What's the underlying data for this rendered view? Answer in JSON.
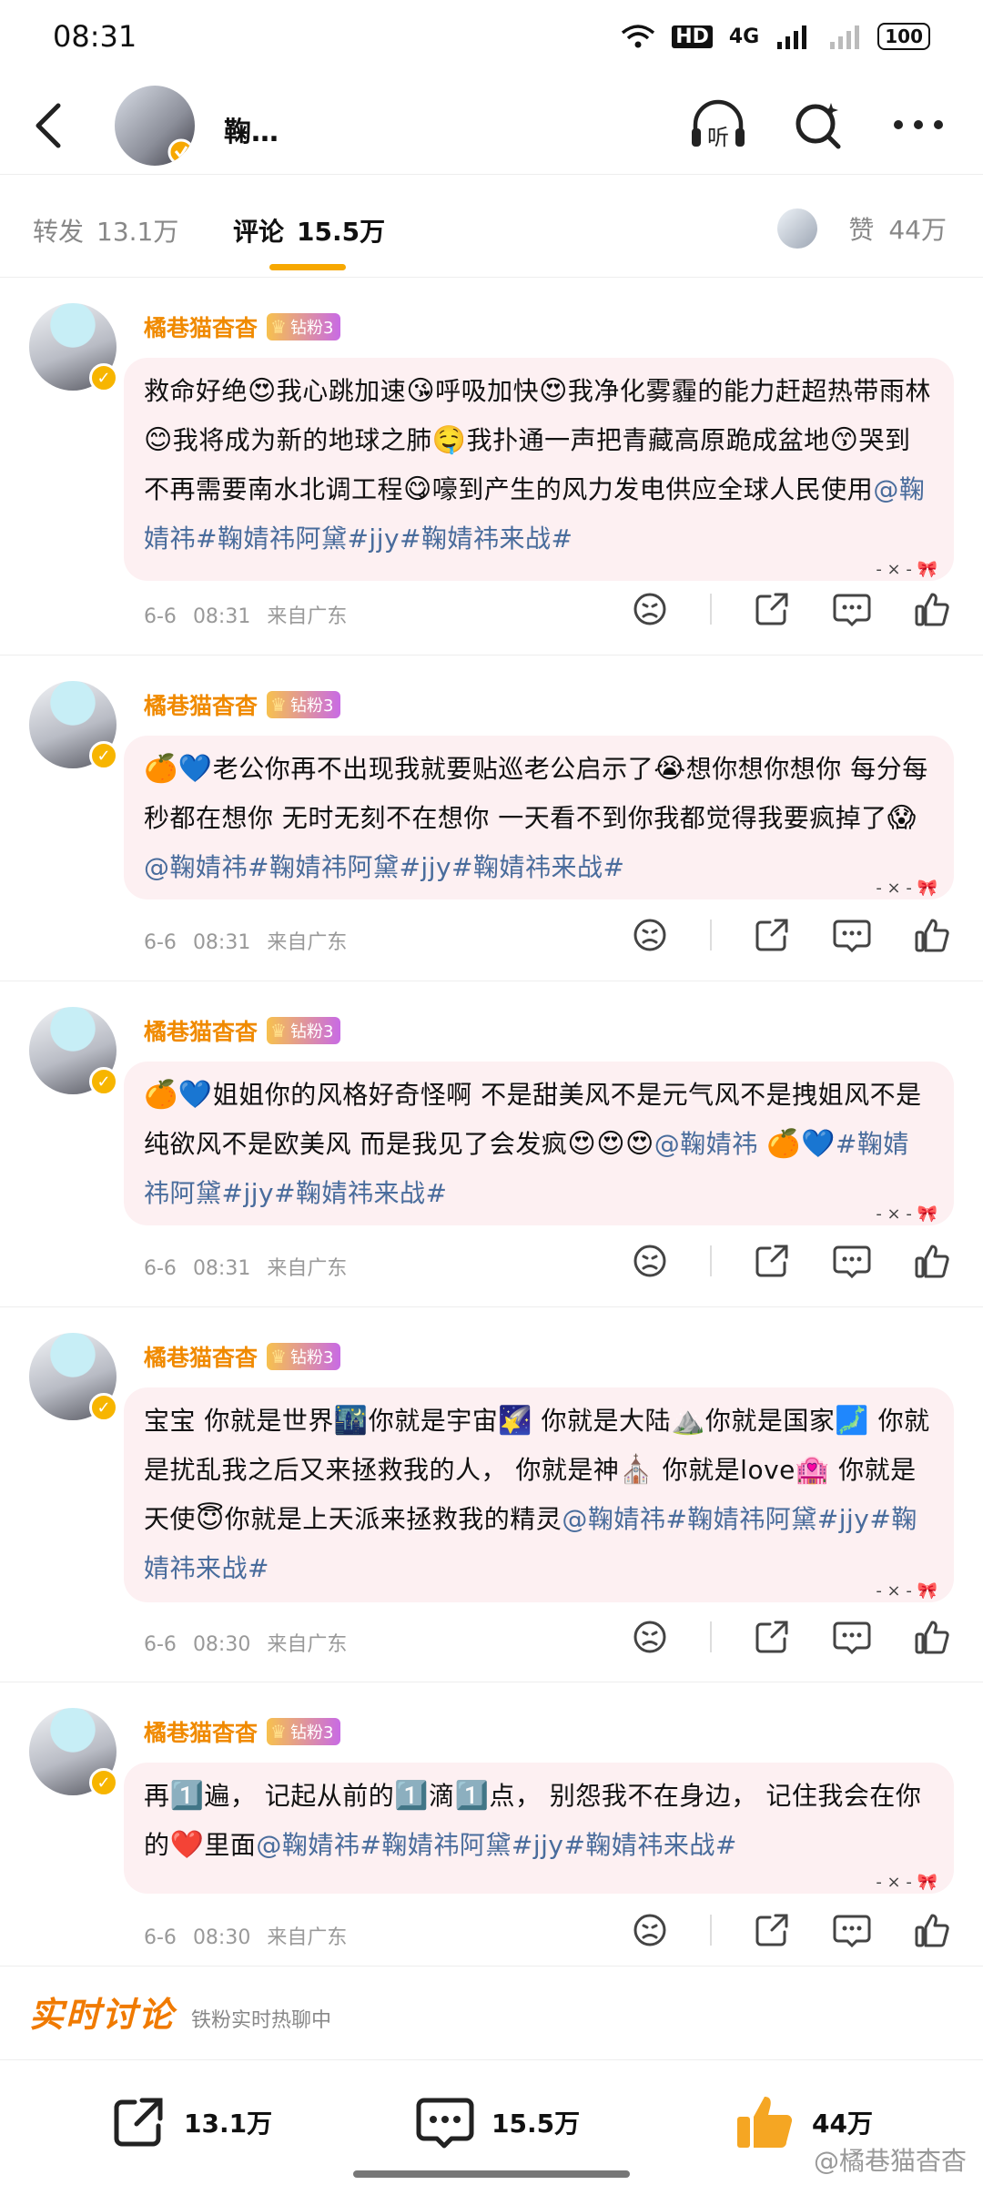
{
  "status": {
    "time": "08:31",
    "hd": "HD",
    "net": "4G",
    "battery": "100"
  },
  "header": {
    "name": "鞠…",
    "back": "back",
    "icons": [
      "listen-icon",
      "search-icon",
      "more-icon"
    ],
    "listen_label": "听"
  },
  "tabs": [
    {
      "label": "转发",
      "count": "13.1万"
    },
    {
      "label": "评论",
      "count": "15.5万"
    }
  ],
  "likes_tab": {
    "label": "赞",
    "count": "44万"
  },
  "comments": [
    {
      "user": "橘巷猫杳杳",
      "fan_badge": "钻粉3",
      "segments": [
        {
          "t": "救命好绝"
        },
        {
          "e": "😍"
        },
        {
          "t": "我心跳加速"
        },
        {
          "e": "😘"
        },
        {
          "t": "呼吸加快"
        },
        {
          "e": "😍"
        },
        {
          "t": "我净化雾霾的能力赶超热带雨林"
        },
        {
          "e": "😊"
        },
        {
          "t": "我将成为新的地球之肺"
        },
        {
          "e": "🤤"
        },
        {
          "t": "我扑通一声把青藏高原跪成盆地"
        },
        {
          "e": "😙"
        },
        {
          "t": "哭到不再需要南水北调工程"
        },
        {
          "e": "😋"
        },
        {
          "t": "嚎到产生的风力发电供应全球人民使用"
        },
        {
          "a": "@鞠婧祎#鞠婧祎阿黛#jjy#鞠婧祎来战#"
        }
      ],
      "date": "6-6",
      "time": "08:31",
      "location": "来自广东"
    },
    {
      "user": "橘巷猫杳杳",
      "fan_badge": "钻粉3",
      "segments": [
        {
          "e": "🍊"
        },
        {
          "e": "💙"
        },
        {
          "t": "老公你再不出现我就要贴巡老公启示了"
        },
        {
          "e": "😭"
        },
        {
          "t": "想你想你想你  每分每秒都在想你  无时无刻不在想你  一天看不到你我都觉得我要疯掉了"
        },
        {
          "e": "😱"
        },
        {
          "a": "@鞠婧祎#鞠婧祎阿黛#jjy#鞠婧祎来战#"
        }
      ],
      "date": "6-6",
      "time": "08:31",
      "location": "来自广东"
    },
    {
      "user": "橘巷猫杳杳",
      "fan_badge": "钻粉3",
      "segments": [
        {
          "e": "🍊"
        },
        {
          "e": "💙"
        },
        {
          "t": "姐姐你的风格好奇怪啊  不是甜美风不是元气风不是拽姐风不是纯欲风不是欧美风  而是我见了会发疯"
        },
        {
          "e": "😍"
        },
        {
          "e": "😍"
        },
        {
          "e": "😍"
        },
        {
          "a": "@鞠婧祎  "
        },
        {
          "e": "🍊"
        },
        {
          "e": "💙"
        },
        {
          "a": "#鞠婧祎阿黛#jjy#鞠婧祎来战#"
        }
      ],
      "date": "6-6",
      "time": "08:31",
      "location": "来自广东"
    },
    {
      "user": "橘巷猫杳杳",
      "fan_badge": "钻粉3",
      "segments": [
        {
          "t": "宝宝  你就是世界"
        },
        {
          "e": "🌃"
        },
        {
          "t": "你就是宇宙"
        },
        {
          "e": "🌠"
        },
        {
          "t": "  你就是大陆"
        },
        {
          "e": "⛰️"
        },
        {
          "t": "你就是国家"
        },
        {
          "e": "🗾"
        },
        {
          "t": "  你就是扰乱我之后又来拯救我的人，  你就是神"
        },
        {
          "e": "⛪"
        },
        {
          "t": "  你就是love"
        },
        {
          "e": "🏩"
        },
        {
          "t": "  你就是天使"
        },
        {
          "e": "😇"
        },
        {
          "t": "你就是上天派来拯救我的精灵"
        },
        {
          "a": "@鞠婧祎#鞠婧祎阿黛#jjy#鞠婧祎来战#"
        }
      ],
      "date": "6-6",
      "time": "08:30",
      "location": "来自广东"
    },
    {
      "user": "橘巷猫杳杳",
      "fan_badge": "钻粉3",
      "segments": [
        {
          "t": "再"
        },
        {
          "e": "1️⃣"
        },
        {
          "t": "遍，  记起从前的"
        },
        {
          "e": "1️⃣"
        },
        {
          "t": "滴"
        },
        {
          "e": "1️⃣"
        },
        {
          "t": "点，  别怨我不在身边，  记住我会在你的"
        },
        {
          "e": "❤️"
        },
        {
          "t": "里面"
        },
        {
          "a": "@鞠婧祎#鞠婧祎阿黛#jjy#鞠婧祎来战#"
        }
      ],
      "date": "6-6",
      "time": "08:30",
      "location": "来自广东"
    }
  ],
  "bow_text": "- × - 🎀",
  "realtime": {
    "title": "实时讨论",
    "subtitle": "铁粉实时热聊中"
  },
  "bottom": {
    "repost": "13.1万",
    "comment": "15.5万",
    "like": "44万"
  },
  "watermark": "@橘巷猫杳杳",
  "colors": {
    "accent": "#f7a800",
    "username": "#f08a00",
    "link": "#496c9c",
    "bubble": "#fdf0f2",
    "like": "#f5a623"
  }
}
